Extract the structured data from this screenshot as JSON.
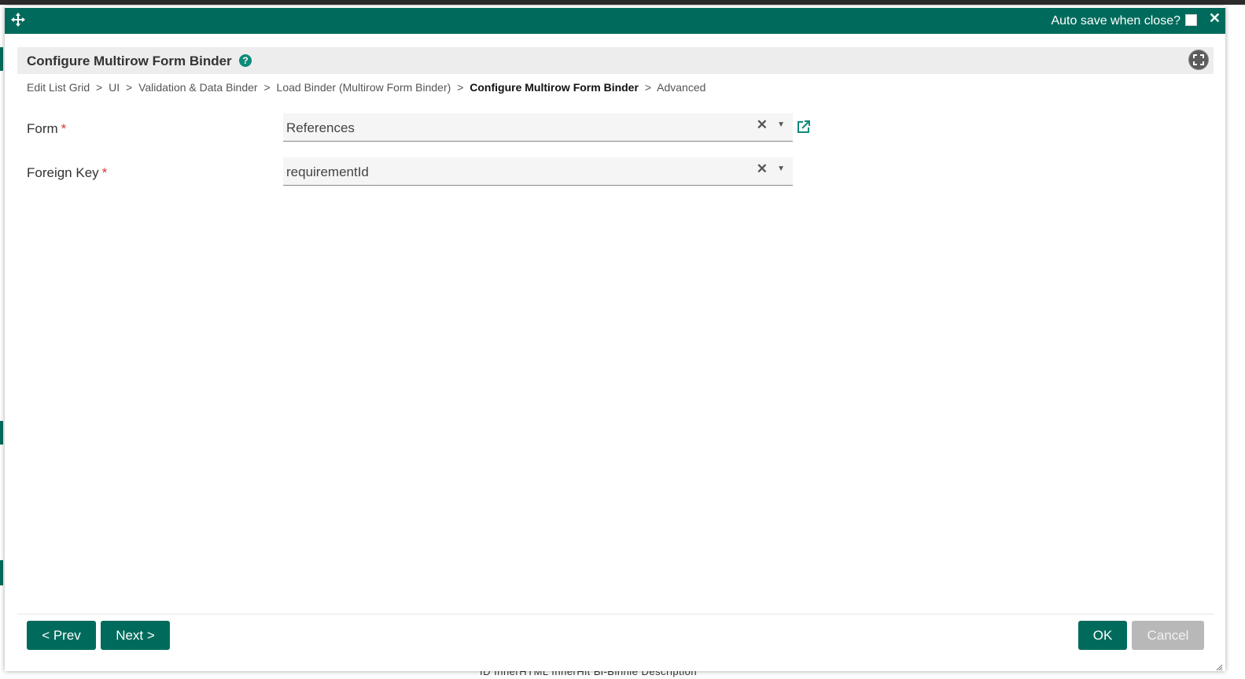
{
  "background": {
    "bottom_text": "ID  InnerHTML   InnerHit   Bi-Binnie Description"
  },
  "titlebar": {
    "move_icon": "move-arrows-icon",
    "autosave_label": "Auto save when close?",
    "autosave_checked": false,
    "close_icon": "close-icon",
    "color": "#006b5c"
  },
  "header": {
    "title": "Configure Multirow Form Binder",
    "help_icon": "?",
    "fullscreen_icon": "fullscreen-icon"
  },
  "breadcrumb": {
    "items": [
      "Edit List Grid",
      "UI",
      "Validation & Data Binder",
      "Load Binder (Multirow Form Binder)",
      "Configure Multirow Form Binder",
      "Advanced"
    ],
    "separator": ">"
  },
  "form": {
    "fields": [
      {
        "label": "Form",
        "required_mark": "*",
        "value": "References",
        "has_link": true
      },
      {
        "label": "Foreign Key",
        "required_mark": "*",
        "value": "requirementId",
        "has_link": false
      }
    ],
    "clear_glyph": "✕",
    "arrow_glyph": "▼"
  },
  "footer": {
    "prev_label": "< Prev",
    "next_label": "Next >",
    "ok_label": "OK",
    "cancel_label": "Cancel"
  }
}
